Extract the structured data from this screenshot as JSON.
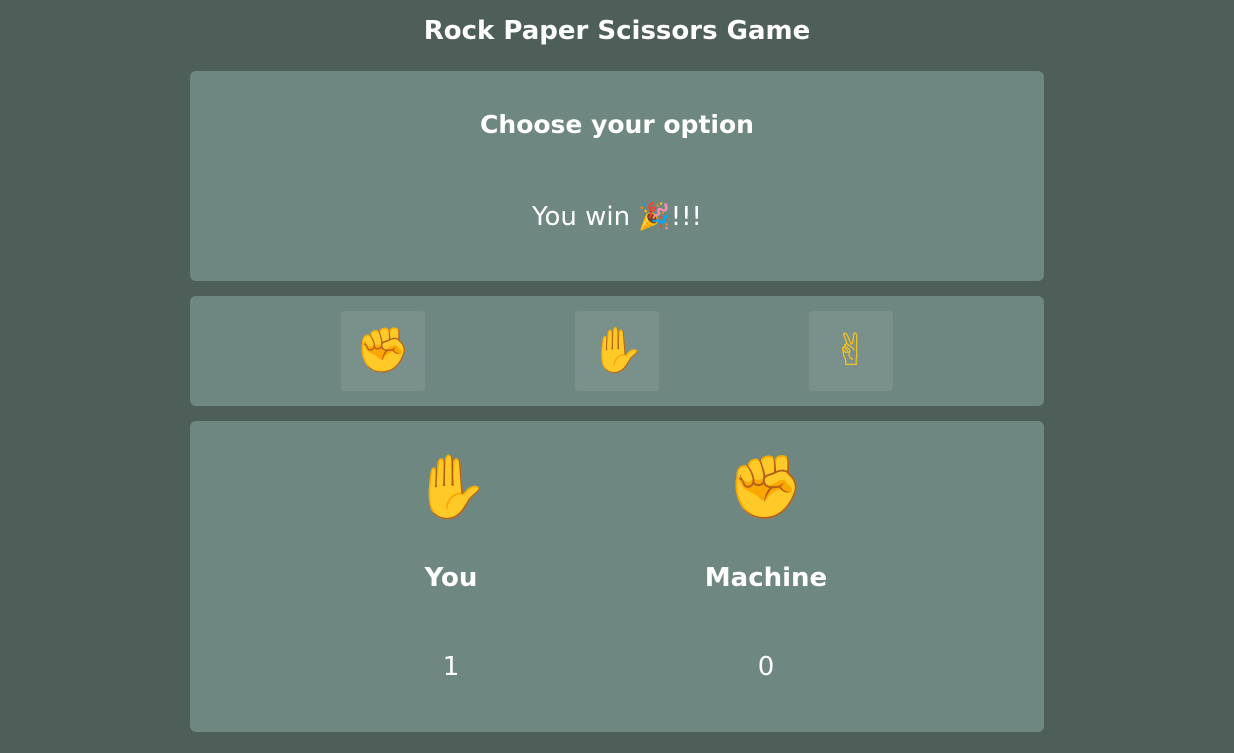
{
  "title": "Rock Paper Scissors Game",
  "status": {
    "heading": "Choose your option",
    "result": "You win 🎉!!!"
  },
  "options": [
    {
      "name": "rock",
      "icon": "✊"
    },
    {
      "name": "paper",
      "icon": "✋"
    },
    {
      "name": "scissors",
      "icon": "✌"
    }
  ],
  "players": {
    "you": {
      "label": "You",
      "choice_icon": "✋",
      "score": "1"
    },
    "machine": {
      "label": "Machine",
      "choice_icon": "✊",
      "score": "0"
    }
  },
  "colors": {
    "background": "#4e5e59",
    "panel": "#6f8781",
    "button": "#7a918b",
    "emoji": "#f4c11f"
  }
}
